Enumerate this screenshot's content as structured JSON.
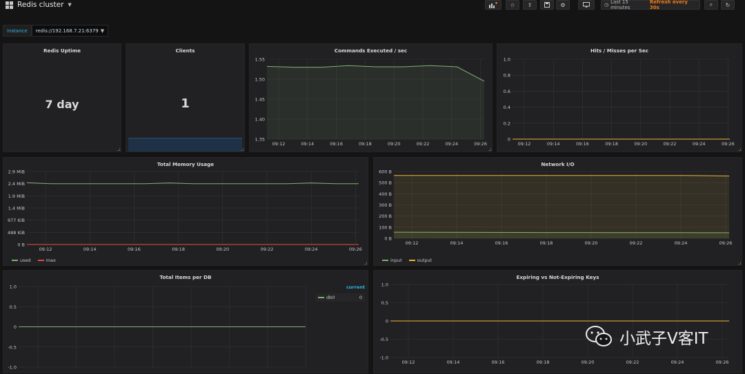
{
  "dashboard": {
    "title": "Redis cluster"
  },
  "toolbar": {
    "time_range": "Last 15 minutes",
    "refresh": "Refresh every 30s"
  },
  "variables": {
    "instance_label": "instance",
    "instance_value": "redis://192.168.7.21:6379"
  },
  "panels": {
    "uptime": {
      "title": "Redis Uptime",
      "value": "7 day"
    },
    "clients": {
      "title": "Clients",
      "value": "1"
    },
    "commands": {
      "title": "Commands Executed / sec"
    },
    "hits": {
      "title": "Hits / Misses per Sec"
    },
    "memory": {
      "title": "Total Memory Usage"
    },
    "network": {
      "title": "Network I/O"
    },
    "items": {
      "title": "Total Items per DB",
      "legend_header": "current",
      "db_label": "db0",
      "db_value": "0"
    },
    "expiring": {
      "title": "Expiring vs Not-Expiring Keys"
    }
  },
  "watermark": {
    "text": "小武子V客IT"
  },
  "colors": {
    "green": "#7eb26d",
    "yellow": "#eab839",
    "red": "#e24d42",
    "blue": "#33b5e5",
    "orange": "#eb7b18"
  },
  "chart_data": [
    {
      "type": "line",
      "title": "Commands Executed / sec",
      "x": [
        "09:12",
        "09:14",
        "09:16",
        "09:18",
        "09:20",
        "09:22",
        "09:24",
        "09:26"
      ],
      "yticks": [
        "1.35",
        "1.40",
        "1.45",
        "1.50",
        "1.55"
      ],
      "ylim": [
        1.35,
        1.55
      ],
      "series": [
        {
          "values": [
            1.532,
            1.53,
            1.53,
            1.534,
            1.531,
            1.531,
            1.534,
            1.531,
            1.495
          ]
        }
      ]
    },
    {
      "type": "line",
      "title": "Hits / Misses per Sec",
      "x": [
        "09:12",
        "09:14",
        "09:16",
        "09:18",
        "09:20",
        "09:22",
        "09:24",
        "09:26"
      ],
      "yticks": [
        "0",
        "0.2",
        "0.4",
        "0.6",
        "0.8",
        "1.0"
      ],
      "ylim": [
        0,
        1
      ],
      "series": [
        {
          "values": [
            0,
            0,
            0,
            0,
            0,
            0,
            0,
            0
          ]
        }
      ]
    },
    {
      "type": "line",
      "title": "Total Memory Usage",
      "x": [
        "09:12",
        "09:14",
        "09:16",
        "09:18",
        "09:20",
        "09:22",
        "09:24",
        "09:26"
      ],
      "yticks": [
        "0 B",
        "488 KiB",
        "977 KiB",
        "1.4 MiB",
        "1.9 MiB",
        "2.4 MiB",
        "2.9 MiB"
      ],
      "ylim": [
        0,
        6
      ],
      "series": [
        {
          "name": "used",
          "values": [
            5.08,
            5.0,
            5.0,
            5.0,
            5.0,
            5.0,
            5.06,
            5.0,
            5.0,
            5.0,
            5.0,
            5.0,
            5.06,
            5.0,
            5.0
          ]
        },
        {
          "name": "max",
          "values": [
            0,
            0
          ]
        }
      ]
    },
    {
      "type": "line",
      "title": "Network I/O",
      "x": [
        "09:12",
        "09:14",
        "09:16",
        "09:18",
        "09:20",
        "09:22",
        "09:24",
        "09:26"
      ],
      "yticks": [
        "0 B",
        "100 B",
        "200 B",
        "300 B",
        "400 B",
        "500 B",
        "600 B"
      ],
      "ylim": [
        0,
        600
      ],
      "series": [
        {
          "name": "input",
          "values": [
            55,
            54,
            53,
            52,
            52,
            51,
            51,
            50
          ]
        },
        {
          "name": "output",
          "values": [
            565,
            565,
            565,
            565,
            565,
            565,
            565,
            560
          ]
        }
      ]
    },
    {
      "type": "line",
      "title": "Total Items per DB",
      "yticks": [
        "-1.0",
        "-0.5",
        "0",
        "0.5",
        "1.0"
      ],
      "ylim": [
        -1,
        1
      ],
      "series": [
        {
          "name": "db0",
          "values": [
            0,
            0
          ]
        }
      ]
    },
    {
      "type": "line",
      "title": "Expiring vs Not-Expiring Keys",
      "x": [
        "09:12",
        "09:14",
        "09:16",
        "09:18",
        "09:20",
        "09:22",
        "09:24",
        "09:26"
      ],
      "yticks": [
        "-1.0",
        "-0.5",
        "0",
        "0.5",
        "1.0"
      ],
      "ylim": [
        -1,
        1
      ],
      "series": [
        {
          "values": [
            0,
            0
          ]
        }
      ]
    }
  ]
}
